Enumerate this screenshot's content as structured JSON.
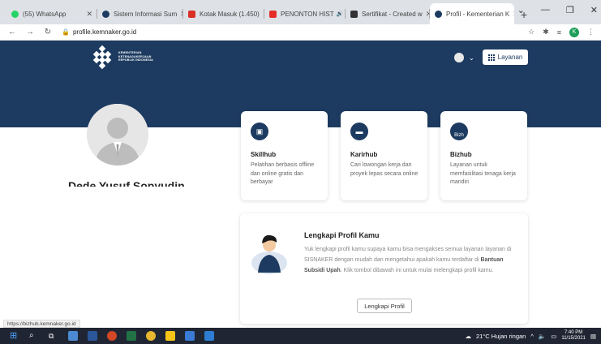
{
  "browser": {
    "tabs": [
      {
        "label": "(55) WhatsApp",
        "color": "#25d366"
      },
      {
        "label": "Sistem Informasi Sum",
        "color": "#1d3b60"
      },
      {
        "label": "Kotak Masuk (1.450)",
        "color": "#d93025"
      },
      {
        "label": "PENONTON HIST",
        "color": "#e52d27"
      },
      {
        "label": "Sertifikat - Created w",
        "color": "#333333"
      },
      {
        "label": "Profil - Kementerian K",
        "color": "#1d3b60"
      }
    ],
    "url": "profile.kemnaker.go.id",
    "new_tab": "+",
    "profile_initial": "K"
  },
  "header": {
    "logo_lines": [
      "KEMENTERIAN",
      "KETENAGAKERJAAN",
      "REPUBLIK INDONESIA"
    ],
    "layanan_label": "Layanan",
    "caret": "⌄"
  },
  "profile": {
    "name": "Dede Yusuf Sopyudin"
  },
  "cards": [
    {
      "title": "Skillhub",
      "desc": "Pelatihan berbasis offline dan online gratis dan berbayar",
      "icon": "skill-icon"
    },
    {
      "title": "Karirhub",
      "desc": "Cari lowongan kerja dan proyek lepas secara online",
      "icon": "briefcase-icon"
    },
    {
      "title": "Bizhub",
      "desc": "Layanan untuk memfasilitasi tenaga kerja mandiri",
      "icon": "biz-icon",
      "icon_text": "Bizh"
    }
  ],
  "complete_profile": {
    "title": "Lengkapi Profil Kamu",
    "body_pre": "Yuk lengkapi profil kamu supaya kamu bisa mengakses semua layanan layanan di SISNAKER dengan mudah dan mengetahui apakah kamu terdaftar di ",
    "body_bold": "Bantuan Subsidi Upah",
    "body_post": ". Klik tombol dibawah ini untuk mulai melengkapi profil kamu.",
    "button": "Lengkapi Profil"
  },
  "status_bar": "https://bizhub.kemnaker.go.id",
  "taskbar": {
    "weather": "21°C  Hujan ringan",
    "time": "7:40 PM",
    "date": "11/15/2021"
  }
}
